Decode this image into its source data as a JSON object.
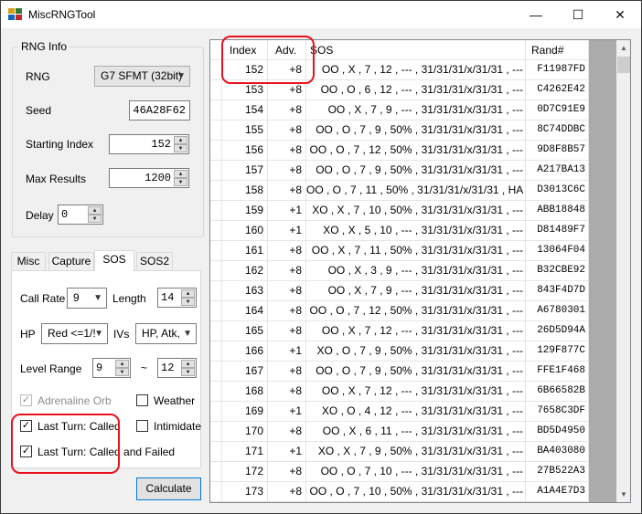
{
  "window": {
    "title": "MiscRNGTool",
    "minimize": "—",
    "maximize": "☐",
    "close": "✕"
  },
  "rng_info": {
    "legend": "RNG Info",
    "rng_label": "RNG",
    "rng_value": "G7 SFMT (32bit)",
    "seed_label": "Seed",
    "seed_value": "46A28F62",
    "starting_index_label": "Starting Index",
    "starting_index_value": "152",
    "max_results_label": "Max Results",
    "max_results_value": "1200",
    "delay_label": "Delay",
    "delay_value": "0"
  },
  "tabs": [
    {
      "label": "Misc"
    },
    {
      "label": "Capture"
    },
    {
      "label": "SOS"
    },
    {
      "label": "SOS2"
    }
  ],
  "active_tab": "SOS",
  "sos": {
    "call_rate_label": "Call Rate",
    "call_rate_value": "9",
    "length_label": "Length",
    "length_value": "14",
    "hp_label": "HP",
    "hp_value": "Red <=1/!",
    "ivs_label": "IVs",
    "ivs_value": "HP, Atk,",
    "level_range_label": "Level Range",
    "level_min": "9",
    "level_sep": "~",
    "level_max": "12",
    "adrenaline_orb_label": "Adrenaline Orb",
    "adrenaline_orb_checked": true,
    "weather_label": "Weather",
    "weather_checked": false,
    "last_turn_called_label": "Last Turn: Called",
    "last_turn_called_checked": true,
    "intimidate_label": "Intimidate",
    "intimidate_checked": false,
    "last_turn_called_failed_label": "Last Turn: Called and Failed",
    "last_turn_called_failed_checked": true
  },
  "calculate_label": "Calculate",
  "grid": {
    "headers": [
      "Index",
      "Adv.",
      "SOS",
      "Rand#"
    ],
    "rows": [
      [
        "152",
        "+8",
        "OO , X , 7 , 12 , --- , 31/31/31/x/31/31 , ---",
        "F11987FD"
      ],
      [
        "153",
        "+8",
        "OO , O , 6 , 12 , --- , 31/31/31/x/31/31 , ---",
        "C4262E42"
      ],
      [
        "154",
        "+8",
        "OO , X , 7 , 9 , --- , 31/31/31/x/31/31 , ---",
        "0D7C91E9"
      ],
      [
        "155",
        "+8",
        "OO , O , 7 , 9 , 50% , 31/31/31/x/31/31 , ---",
        "8C74DDBC"
      ],
      [
        "156",
        "+8",
        "OO , O , 7 , 12 , 50% , 31/31/31/x/31/31 , ---",
        "9D8F8B57"
      ],
      [
        "157",
        "+8",
        "OO , O , 7 , 9 , 50% , 31/31/31/x/31/31 , ---",
        "A217BA13"
      ],
      [
        "158",
        "+8",
        "OO , O , 7 , 11 , 50% , 31/31/31/x/31/31 , HA",
        "D3013C6C"
      ],
      [
        "159",
        "+1",
        "XO , X , 7 , 10 , 50% , 31/31/31/x/31/31 , ---",
        "ABB18848"
      ],
      [
        "160",
        "+1",
        "XO , X , 5 , 10 , --- , 31/31/31/x/31/31 , ---",
        "D81489F7"
      ],
      [
        "161",
        "+8",
        "OO , X , 7 , 11 , 50% , 31/31/31/x/31/31 , ---",
        "13064F04"
      ],
      [
        "162",
        "+8",
        "OO , X , 3 , 9 , --- , 31/31/31/x/31/31 , ---",
        "B32CBE92"
      ],
      [
        "163",
        "+8",
        "OO , X , 7 , 9 , --- , 31/31/31/x/31/31 , ---",
        "843F4D7D"
      ],
      [
        "164",
        "+8",
        "OO , O , 7 , 12 , 50% , 31/31/31/x/31/31 , ---",
        "A6780301"
      ],
      [
        "165",
        "+8",
        "OO , X , 7 , 12 , --- , 31/31/31/x/31/31 , ---",
        "26D5D94A"
      ],
      [
        "166",
        "+1",
        "XO , O , 7 , 9 , 50% , 31/31/31/x/31/31 , ---",
        "129F877C"
      ],
      [
        "167",
        "+8",
        "OO , O , 7 , 9 , 50% , 31/31/31/x/31/31 , ---",
        "FFE1F468"
      ],
      [
        "168",
        "+8",
        "OO , X , 7 , 12 , --- , 31/31/31/x/31/31 , ---",
        "6B66582B"
      ],
      [
        "169",
        "+1",
        "XO , O , 4 , 12 , --- , 31/31/31/x/31/31 , ---",
        "7658C3DF"
      ],
      [
        "170",
        "+8",
        "OO , X , 6 , 11 , --- , 31/31/31/x/31/31 , ---",
        "BD5D4950"
      ],
      [
        "171",
        "+1",
        "XO , X , 7 , 9 , 50% , 31/31/31/x/31/31 , ---",
        "BA403080"
      ],
      [
        "172",
        "+8",
        "OO , O , 7 , 10 , --- , 31/31/31/x/31/31 , ---",
        "27B522A3"
      ],
      [
        "173",
        "+8",
        "OO , O , 7 , 10 , 50% , 31/31/31/x/31/31 , ---",
        "A1A4E7D3"
      ]
    ]
  },
  "colors": {
    "annotation": "#e8111c",
    "accent": "#0078d7"
  }
}
